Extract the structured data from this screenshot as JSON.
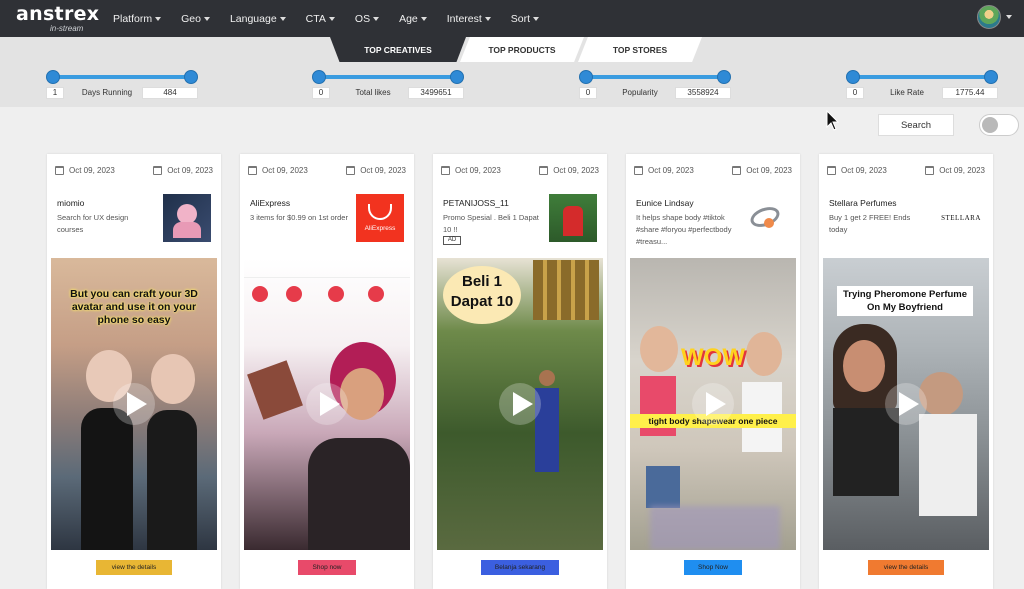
{
  "app": {
    "logo": "anstrex",
    "logo_sub": "in-stream"
  },
  "nav": [
    {
      "label": "Platform"
    },
    {
      "label": "Geo"
    },
    {
      "label": "Language"
    },
    {
      "label": "CTA"
    },
    {
      "label": "OS"
    },
    {
      "label": "Age"
    },
    {
      "label": "Interest"
    },
    {
      "label": "Sort"
    }
  ],
  "tabs": [
    {
      "label": "TOP CREATIVES",
      "active": true
    },
    {
      "label": "TOP PRODUCTS",
      "active": false
    },
    {
      "label": "TOP STORES",
      "active": false
    }
  ],
  "filters": [
    {
      "label": "Days Running",
      "min": "1",
      "max": "484"
    },
    {
      "label": "Total likes",
      "min": "0",
      "max": "3499651"
    },
    {
      "label": "Popularity",
      "min": "0",
      "max": "3558924"
    },
    {
      "label": "Like Rate",
      "min": "0",
      "max": "1775.44"
    }
  ],
  "search": {
    "label": "Search",
    "toggle_on": false
  },
  "cards": [
    {
      "date_start": "Oct 09, 2023",
      "date_end": "Oct 09, 2023",
      "name": "miomio",
      "desc": "Search for UX design courses",
      "overlay": "But you can craft your 3D avatar and use it on your phone so easy",
      "cta": "view the details",
      "cta_color": "#e8b634"
    },
    {
      "date_start": "Oct 09, 2023",
      "date_end": "Oct 09, 2023",
      "name": "AliExpress",
      "desc": "3 items for $0.99 on 1st order",
      "thumb_text": "AliExpress",
      "cta": "Shop now",
      "cta_color": "#e84a6a"
    },
    {
      "date_start": "Oct 09, 2023",
      "date_end": "Oct 09, 2023",
      "name": "PETANIJOSS_11",
      "desc": "Promo Spesial . Beli 1 Dapat 10 !!",
      "badge": "AD",
      "overlay": "Beli 1 Dapat 10",
      "cta": "Belanja sekarang",
      "cta_color": "#3b5fe0"
    },
    {
      "date_start": "Oct 09, 2023",
      "date_end": "Oct 09, 2023",
      "name": "Eunice Lindsay",
      "desc": "It helps shape body #tiktok #share #foryou #perfectbody #treasu...",
      "overlay": "WOW",
      "overlay2": "tight body shapewear one piece",
      "cta": "Shop Now",
      "cta_color": "#1f8ef0"
    },
    {
      "date_start": "Oct 09, 2023",
      "date_end": "Oct 09, 2023",
      "name": "Stellara Perfumes",
      "desc": "Buy 1 get 2 FREE! Ends today",
      "thumb_text": "STELLARA",
      "overlay": "Trying Pheromone Perfume On My Boyfriend",
      "cta": "view the details",
      "cta_color": "#f07a30"
    }
  ]
}
